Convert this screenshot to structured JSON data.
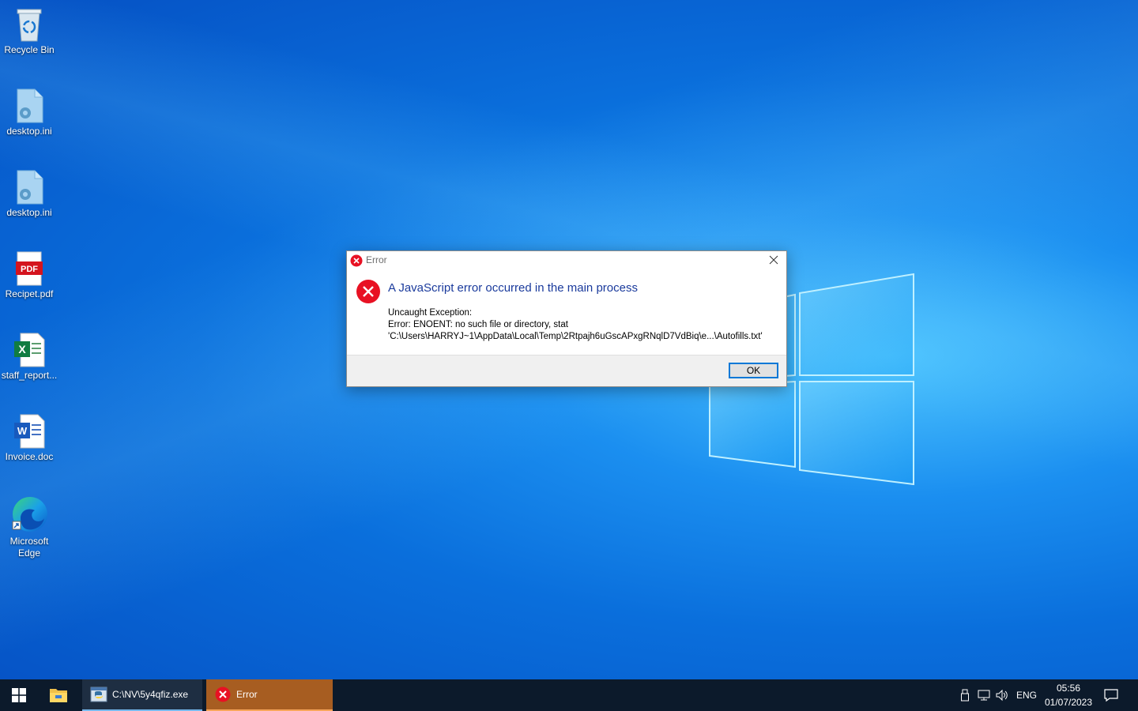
{
  "desktop": {
    "icons": [
      {
        "label": "Recycle Bin"
      },
      {
        "label": "desktop.ini"
      },
      {
        "label": "desktop.ini"
      },
      {
        "label": "Recipet.pdf",
        "badge": "PDF"
      },
      {
        "label": "staff_report..."
      },
      {
        "label": "Invoice.doc"
      },
      {
        "label": "Microsoft Edge"
      }
    ]
  },
  "dialog": {
    "title": "Error",
    "heading": "A JavaScript error occurred in the main process",
    "message_lines": [
      "Uncaught Exception:",
      "Error: ENOENT: no such file or directory, stat",
      "'C:\\Users\\HARRYJ~1\\AppData\\Local\\Temp\\2Rtpajh6uGscAPxgRNqlD7VdBiq\\e...\\Autofills.txt'"
    ],
    "ok_label": "OK",
    "icon": "error-icon"
  },
  "taskbar": {
    "tasks": [
      {
        "label": "C:\\NV\\5y4qfiz.exe",
        "icon": "python-exe-icon"
      },
      {
        "label": "Error",
        "icon": "error-icon"
      }
    ],
    "tray": {
      "language": "ENG",
      "time": "05:56",
      "date": "01/07/2023"
    }
  },
  "colors": {
    "accent": "#0078d7",
    "error_red": "#e81123",
    "active_task": "#a75d21",
    "heading_blue": "#1a3a9c"
  }
}
